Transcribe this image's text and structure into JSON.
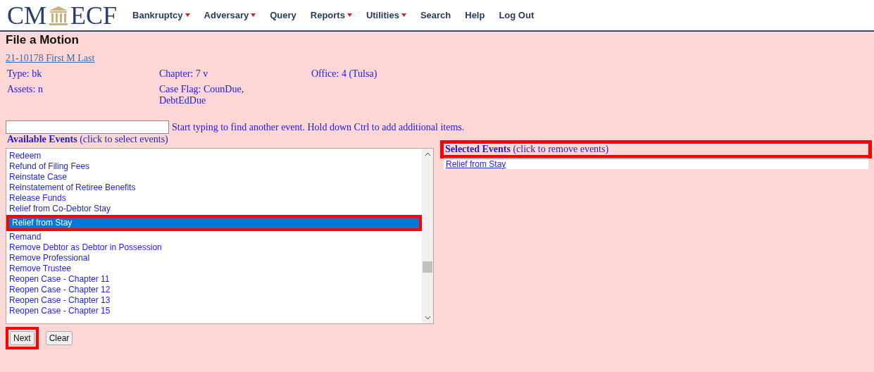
{
  "header": {
    "logo_left": "CM",
    "logo_right": "ECF",
    "menu": [
      {
        "label": "Bankruptcy",
        "dropdown": true
      },
      {
        "label": "Adversary",
        "dropdown": true
      },
      {
        "label": "Query",
        "dropdown": false
      },
      {
        "label": "Reports",
        "dropdown": true
      },
      {
        "label": "Utilities",
        "dropdown": true
      },
      {
        "label": "Search",
        "dropdown": false
      },
      {
        "label": "Help",
        "dropdown": false
      },
      {
        "label": "Log Out",
        "dropdown": false
      }
    ]
  },
  "page_title": "File a Motion",
  "case_link": "21-10178 First M Last",
  "case_info": [
    [
      "Type: bk",
      "Chapter: 7 v",
      "Office: 4 (Tulsa)"
    ],
    [
      "Assets: n",
      "Case Flag: CounDue, DebtEdDue"
    ]
  ],
  "search": {
    "hint": "Start typing to find another event. Hold down Ctrl to add additional items."
  },
  "available": {
    "title": "Available Events",
    "note": "(click to select events)",
    "items": [
      {
        "label": "Redeem",
        "selected": false,
        "highlighted": false
      },
      {
        "label": "Refund of Filing Fees",
        "selected": false,
        "highlighted": false
      },
      {
        "label": "Reinstate Case",
        "selected": false,
        "highlighted": false
      },
      {
        "label": "Reinstatement of Retiree Benefits",
        "selected": false,
        "highlighted": false
      },
      {
        "label": "Release Funds",
        "selected": false,
        "highlighted": false
      },
      {
        "label": "Relief from Co-Debtor Stay",
        "selected": false,
        "highlighted": false
      },
      {
        "label": "Relief from Stay",
        "selected": true,
        "highlighted": true
      },
      {
        "label": "Remand",
        "selected": false,
        "highlighted": false
      },
      {
        "label": "Remove Debtor as Debtor in Possession",
        "selected": false,
        "highlighted": false
      },
      {
        "label": "Remove Professional",
        "selected": false,
        "highlighted": false
      },
      {
        "label": "Remove Trustee",
        "selected": false,
        "highlighted": false
      },
      {
        "label": "Reopen Case - Chapter 11",
        "selected": false,
        "highlighted": false
      },
      {
        "label": "Reopen Case - Chapter 12",
        "selected": false,
        "highlighted": false
      },
      {
        "label": "Reopen Case - Chapter 13",
        "selected": false,
        "highlighted": false
      },
      {
        "label": "Reopen Case - Chapter 15",
        "selected": false,
        "highlighted": false
      }
    ]
  },
  "selected_events": {
    "title": "Selected Events",
    "note": "(click to remove events)",
    "highlighted": true,
    "items": [
      "Relief from Stay"
    ]
  },
  "buttons": [
    {
      "label": "Next",
      "highlighted": true
    },
    {
      "label": "Clear",
      "highlighted": false
    }
  ]
}
